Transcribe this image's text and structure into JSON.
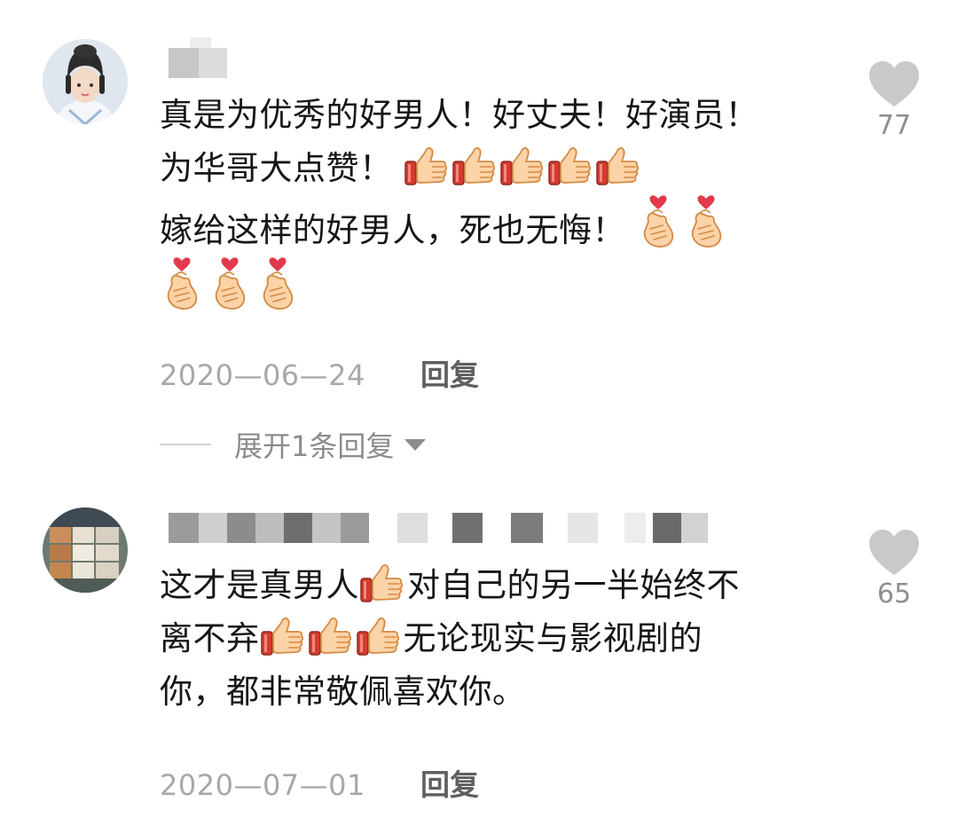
{
  "comments": [
    {
      "avatar_icon": "avatar-costume-woman",
      "lines": [
        {
          "segments": [
            {
              "text": "真是为优秀的好男人！好丈夫！好演员！"
            }
          ]
        },
        {
          "segments": [
            {
              "text": "为华哥大点赞！ "
            },
            {
              "emoji": "thumbs-up-icon"
            },
            {
              "emoji": "thumbs-up-icon"
            },
            {
              "emoji": "thumbs-up-icon"
            },
            {
              "emoji": "thumbs-up-icon"
            },
            {
              "emoji": "thumbs-up-icon"
            }
          ]
        },
        {
          "segments": [
            {
              "text": "嫁给这样的好男人，死也无悔！ "
            },
            {
              "emoji": "finger-heart-icon"
            },
            {
              "emoji": "finger-heart-icon"
            }
          ]
        },
        {
          "segments": [
            {
              "emoji": "finger-heart-icon"
            },
            {
              "emoji": "finger-heart-icon"
            },
            {
              "emoji": "finger-heart-icon"
            }
          ]
        }
      ],
      "likes": "77",
      "date": "2020—06—24",
      "reply_label": "回复",
      "expand_label": "展开1条回复"
    },
    {
      "avatar_icon": "avatar-boxes-photo",
      "lines": [
        {
          "segments": [
            {
              "text": "这才是真男人"
            },
            {
              "emoji": "thumbs-up-icon"
            },
            {
              "text": "对自己的另一半始终不"
            }
          ]
        },
        {
          "segments": [
            {
              "text": "离不弃"
            },
            {
              "emoji": "thumbs-up-icon"
            },
            {
              "emoji": "thumbs-up-icon"
            },
            {
              "emoji": "thumbs-up-icon"
            },
            {
              "text": "无论现实与影视剧的"
            }
          ]
        },
        {
          "segments": [
            {
              "text": "你，都非常敬佩喜欢你。"
            }
          ]
        }
      ],
      "likes": "65",
      "date": "2020—07—01",
      "reply_label": "回复"
    }
  ],
  "colors": {
    "text": "#161616",
    "meta": "#a8a8a8",
    "reply": "#5f5f5f",
    "heart": "#c9c9c9",
    "count": "#8e8e8e"
  }
}
